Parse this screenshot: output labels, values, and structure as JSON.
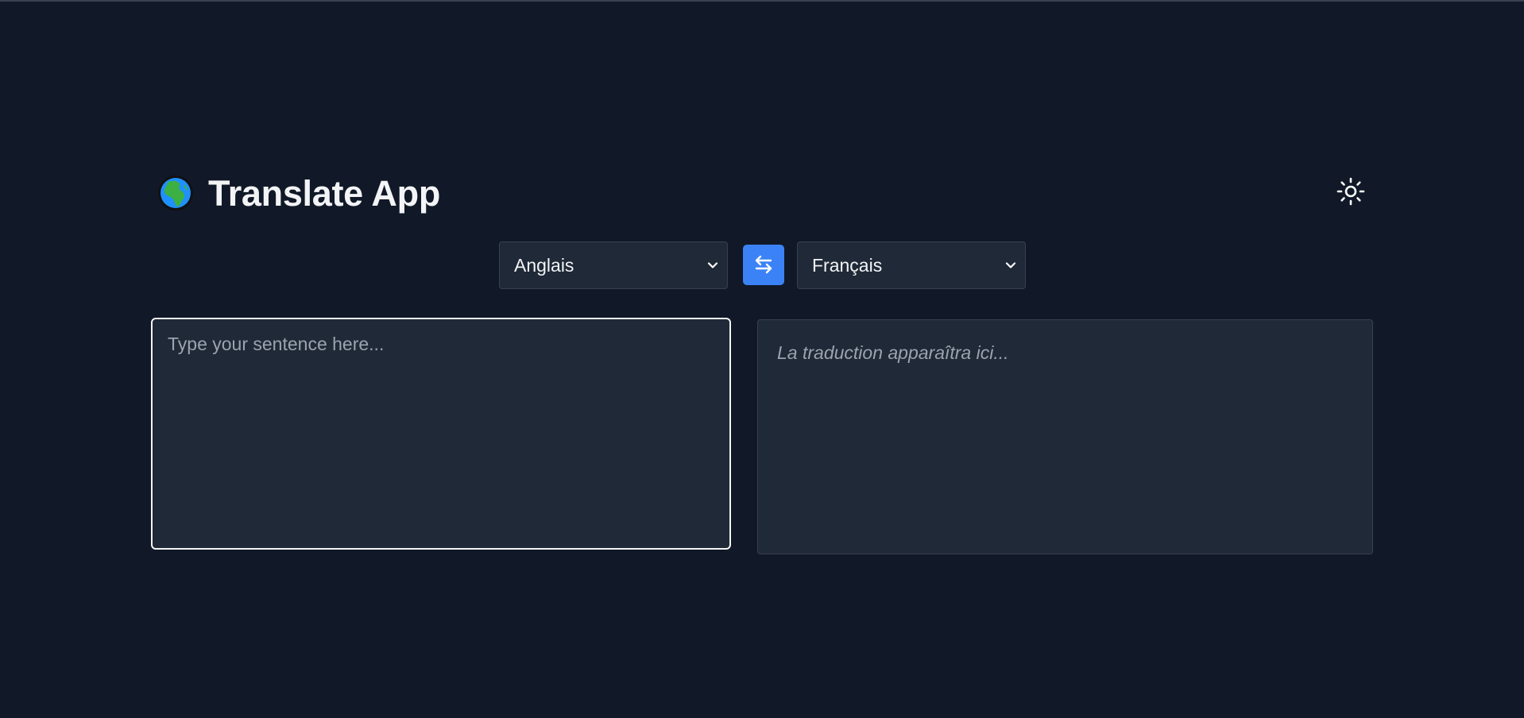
{
  "header": {
    "title": "Translate App",
    "logo_icon": "globe-africa-icon",
    "theme_toggle_icon": "sun-icon"
  },
  "languages": {
    "source_selected": "Anglais",
    "target_selected": "Français",
    "swap_icon": "swap-arrows-icon"
  },
  "source": {
    "placeholder": "Type your sentence here...",
    "value": ""
  },
  "output": {
    "placeholder": "La traduction apparaîtra ici..."
  },
  "colors": {
    "background": "#111827",
    "panel": "#1f2937",
    "accent": "#3b82f6",
    "text": "#f3f4f6",
    "muted": "#9ca3af"
  }
}
